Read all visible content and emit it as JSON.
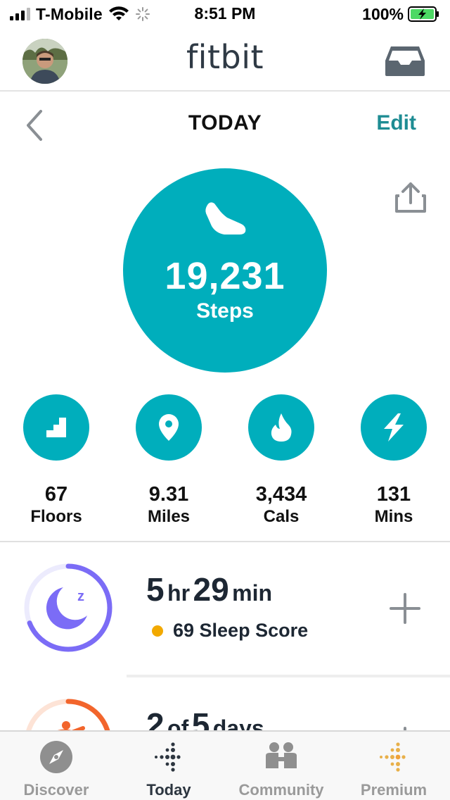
{
  "status_bar": {
    "carrier": "T-Mobile",
    "time": "8:51 PM",
    "battery": "100%"
  },
  "header": {
    "brand": "fitbit"
  },
  "day_nav": {
    "title": "TODAY",
    "edit_label": "Edit"
  },
  "steps": {
    "value": "19,231",
    "label": "Steps"
  },
  "stats": [
    {
      "value": "67",
      "label": "Floors",
      "icon": "stairs-icon"
    },
    {
      "value": "9.31",
      "label": "Miles",
      "icon": "location-pin-icon"
    },
    {
      "value": "3,434",
      "label": "Cals",
      "icon": "flame-icon"
    },
    {
      "value": "131",
      "label": "Mins",
      "icon": "lightning-icon"
    }
  ],
  "sleep": {
    "hours": "5",
    "hours_unit": "hr",
    "minutes": "29",
    "minutes_unit": "min",
    "score_text": "69 Sleep Score",
    "score_color": "#f2a900",
    "ring_progress": 0.69
  },
  "exercise": {
    "count": "2",
    "of_text": "of",
    "total": "5",
    "unit": "days"
  },
  "tabs": [
    {
      "label": "Discover",
      "icon": "compass-icon",
      "active": false
    },
    {
      "label": "Today",
      "icon": "fitbit-dots-icon",
      "active": true
    },
    {
      "label": "Community",
      "icon": "community-people-icon",
      "active": false
    },
    {
      "label": "Premium",
      "icon": "premium-dots-icon",
      "active": false
    }
  ],
  "colors": {
    "accent_teal": "#00aebc",
    "edit_teal": "#1e8c93",
    "sleep_purple": "#7b6cf6",
    "exercise_orange": "#f2652c"
  }
}
